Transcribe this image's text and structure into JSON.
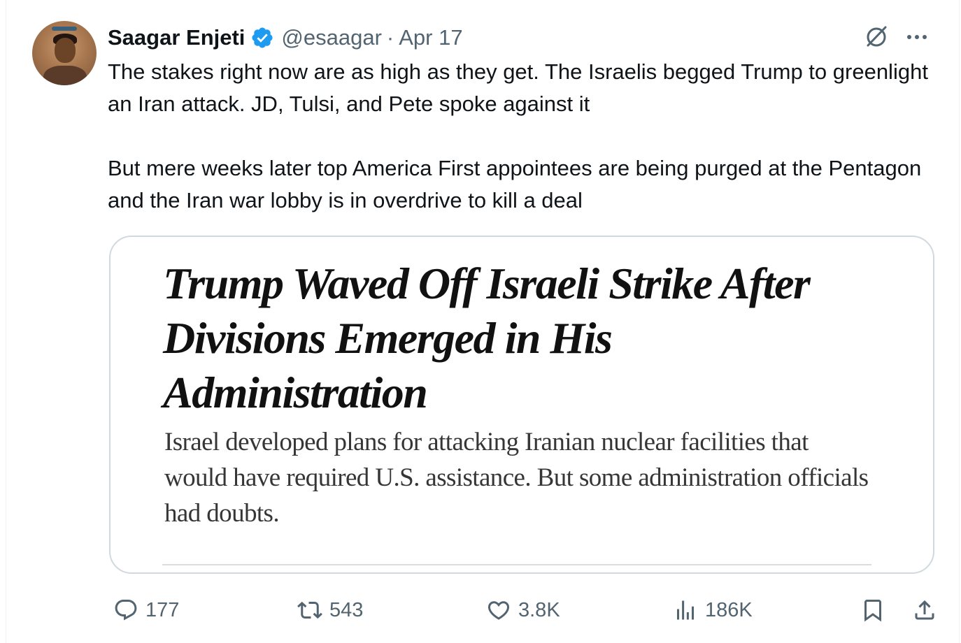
{
  "author": {
    "name": "Saagar Enjeti",
    "handle": "@esaagar",
    "separator": "·",
    "date": "Apr 17",
    "verified": true,
    "avatar_icon": "profile-photo"
  },
  "tweet": {
    "paragraphs": [
      "The stakes right now are as high as they get. The Israelis begged Trump to greenlight an Iran attack. JD, Tulsi, and Pete spoke against it",
      "But mere weeks later top America First appointees are being purged at the Pentagon and the Iran war lobby is in overdrive to kill a deal"
    ]
  },
  "card": {
    "headline": "Trump Waved Off Israeli Strike After Divisions Emerged in His Administration",
    "summary": "Israel developed plans for attacking Iranian nuclear facilities that would have required U.S. assistance. But some administration officials had doubts."
  },
  "actions": {
    "replies": "177",
    "reposts": "543",
    "likes": "3.8K",
    "views": "186K"
  },
  "icons": {
    "verified": "verified-badge-icon",
    "grok": "grok-icon",
    "more": "more-options-icon",
    "reply": "reply-icon",
    "repost": "repost-icon",
    "like": "heart-icon",
    "views": "analytics-icon",
    "bookmark": "bookmark-icon",
    "share": "share-icon"
  },
  "colors": {
    "text": "#0f1419",
    "secondary": "#536471",
    "verified": "#1d9bf0",
    "border": "#cfd9de"
  }
}
